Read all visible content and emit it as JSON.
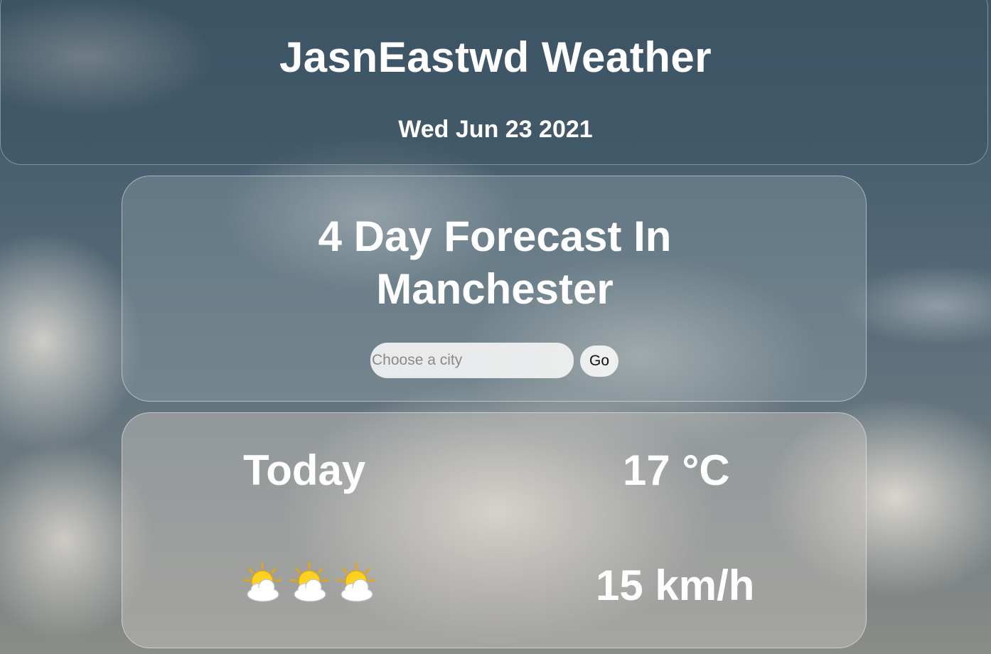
{
  "header": {
    "title": "JasnEastwd Weather",
    "date": "Wed Jun 23 2021"
  },
  "search": {
    "heading_line1": "4 Day Forecast In",
    "heading_line2": "Manchester",
    "placeholder": "Choose a city",
    "value": "",
    "go_label": "Go"
  },
  "today": {
    "day": "Today",
    "temperature": "17 °C",
    "wind": "15 km/h",
    "icons": [
      "sun-behind-cloud-icon",
      "sun-behind-cloud-icon",
      "sun-behind-cloud-icon"
    ]
  }
}
